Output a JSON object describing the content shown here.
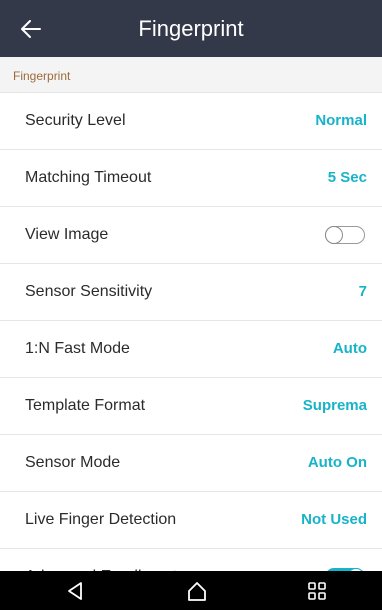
{
  "app_bar": {
    "title": "Fingerprint",
    "back_icon": "arrow-left-icon"
  },
  "section": {
    "title": "Fingerprint"
  },
  "rows": [
    {
      "label": "Security Level",
      "value": "Normal"
    },
    {
      "label": "Matching Timeout",
      "value": "5 Sec"
    },
    {
      "label": "View Image",
      "toggle": "off"
    },
    {
      "label": "Sensor Sensitivity",
      "value": "7"
    },
    {
      "label": "1:N Fast Mode",
      "value": "Auto"
    },
    {
      "label": "Template Format",
      "value": "Suprema"
    },
    {
      "label": "Sensor Mode",
      "value": "Auto On"
    },
    {
      "label": "Live Finger Detection",
      "value": "Not Used"
    },
    {
      "label": "Advanced Enrollment",
      "toggle": "on"
    }
  ],
  "nav_bar": {
    "back_icon": "nav-back-triangle-icon",
    "home_icon": "nav-home-icon",
    "recents_icon": "nav-recents-grid-icon"
  },
  "colors": {
    "app_bar_bg": "#34394a",
    "accent": "#17b4c9",
    "section_text": "#9b6b3d",
    "nav_bar_bg": "#000000"
  }
}
